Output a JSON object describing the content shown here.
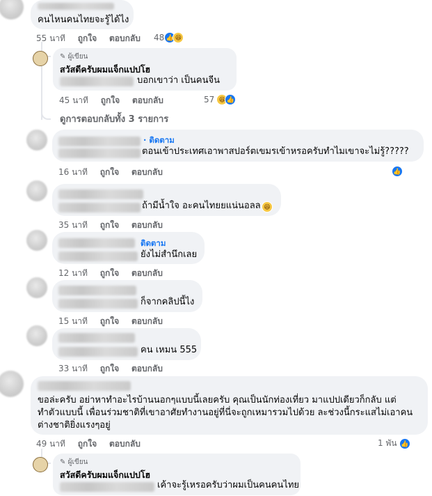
{
  "comments": [
    {
      "text": "คนไหนคนไทยจะรู้ได้ไง",
      "time": "55 นาที",
      "like": "ถูกใจ",
      "reply": "ตอบกลับ",
      "reactions": "48"
    },
    {
      "author_tag": "ผู้เขียน",
      "name": "สวัสดีครับผมแจ็กแปปโฮ",
      "text": "บอกเขาว่า  เป็นคนจีน",
      "time": "45 นาที",
      "like": "ถูกใจ",
      "reply": "ตอบกลับ",
      "reactions": "57"
    },
    {
      "see_replies": "ดูการตอบกลับทั้ง 3 รายการ"
    },
    {
      "follow": "· ติดตาม",
      "text": "ตอนเข้าประเทศเอาพาสปอร์ตเขมรเข้าหรอครับทำไมเขาจะไม่รู้?????",
      "time": "16 นาที",
      "like": "ถูกใจ",
      "reply": "ตอบกลับ"
    },
    {
      "text": "ถ้ามีน้ำใจ อะคนไทยยแน่นอลล",
      "time": "35 นาที",
      "like": "ถูกใจ",
      "reply": "ตอบกลับ"
    },
    {
      "follow": "ติดตาม",
      "text": "ยังไม่สำนึกเลย",
      "time": "12 นาที",
      "like": "ถูกใจ",
      "reply": "ตอบกลับ"
    },
    {
      "text": "ก็จากคลิปนี้ไง",
      "time": "15 นาที",
      "like": "ถูกใจ",
      "reply": "ตอบกลับ"
    },
    {
      "text": "คน เหมน 555",
      "time": "33 นาที",
      "like": "ถูกใจ",
      "reply": "ตอบกลับ"
    },
    {
      "text": "ขอล่ะครับ อย่าหาทำอะไรบ้านนอกๆแบบนี้เลยครับ คุณเป็นนักท่องเที่ยว มาแปปเดียวก็กลับ แต่ ทำตัวแบบนี้ เพื่อนร่วมชาติที่เขาอาศัยทำงานอยู่ที่นี่จะถูกเหมารวมไปด้วย ละช่วงนี้กระแสไม่เอาคน ต่างชาติยิ่งแรงๆอยู่",
      "time": "49 นาที",
      "like": "ถูกใจ",
      "reply": "ตอบกลับ",
      "reactions": "1 พัน"
    },
    {
      "author_tag": "ผู้เขียน",
      "name": "สวัสดีครับผมแจ็กแปปโฮ",
      "text": "เค้าจะรู้เหรอครับว่าผมเป็นคนคนไทย"
    }
  ],
  "icons": {
    "like": "like-icon",
    "haha": "haha-icon",
    "pencil": "pencil-icon"
  },
  "colors": {
    "link": "#1877f2",
    "meta": "#65676b",
    "bubble": "#f0f2f5"
  }
}
